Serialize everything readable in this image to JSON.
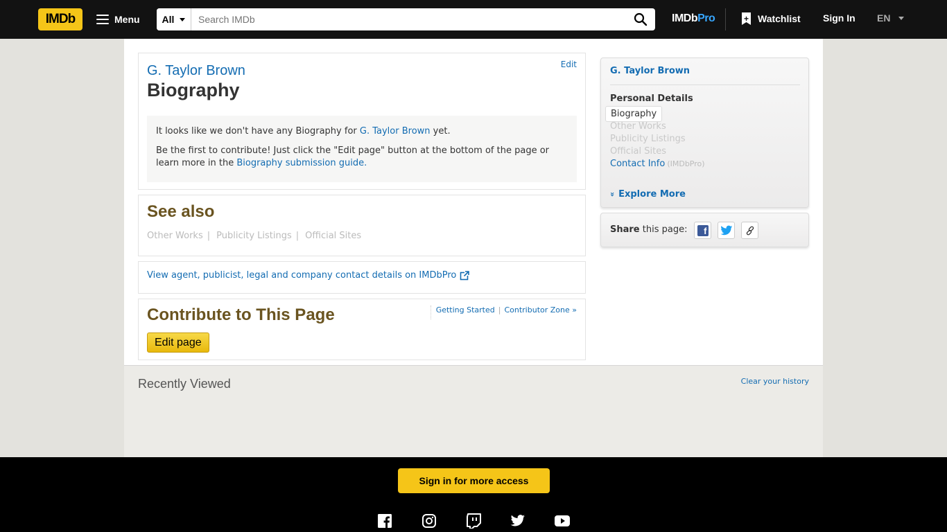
{
  "nav": {
    "logo": "IMDb",
    "menu_label": "Menu",
    "search_category": "All",
    "search_placeholder": "Search IMDb",
    "imdbpro_prefix": "IMDb",
    "imdbpro_suffix": "Pro",
    "watchlist_label": "Watchlist",
    "signin_label": "Sign In",
    "language": "EN"
  },
  "bio": {
    "person_name": "G. Taylor Brown",
    "title": "Biography",
    "edit_label": "Edit",
    "empty_prefix": "It looks like we don't have any Biography for",
    "empty_name_link": "G. Taylor Brown",
    "empty_suffix": "yet.",
    "contribute_text": "Be the first to contribute! Just click the \"Edit page\" button at the bottom of the page or learn more in the",
    "guide_link": "Biography submission guide",
    "guide_suffix": "."
  },
  "see_also": {
    "title": "See also",
    "links": [
      "Other Works",
      "Publicity Listings",
      "Official Sites"
    ],
    "separator": "|"
  },
  "pro": {
    "link_text": "View agent, publicist, legal and company contact details on IMDbPro"
  },
  "contribute": {
    "title": "Contribute to This Page",
    "getting_started": "Getting Started",
    "separator": "|",
    "contributor_zone": "Contributor Zone »",
    "edit_button": "Edit page"
  },
  "sidebar": {
    "person_name": "G. Taylor Brown",
    "section_heading": "Personal Details",
    "active_item": "Biography",
    "items": [
      "Other Works",
      "Publicity Listings",
      "Official Sites"
    ],
    "contact_label": "Contact Info",
    "contact_sub": "(IMDbPro)",
    "explore_label": "Explore More",
    "explore_icon": "»"
  },
  "share": {
    "label_bold": "Share",
    "label_rest": "this page:",
    "facebook_icon": "f"
  },
  "recent": {
    "title": "Recently Viewed",
    "clear_label": "Clear your history"
  },
  "footer": {
    "signin_button": "Sign in for more access"
  },
  "colors": {
    "brand_yellow": "#f5c518",
    "link_blue": "#136cb2",
    "heading_brown": "#6a5420",
    "topbar_black": "#121212"
  }
}
